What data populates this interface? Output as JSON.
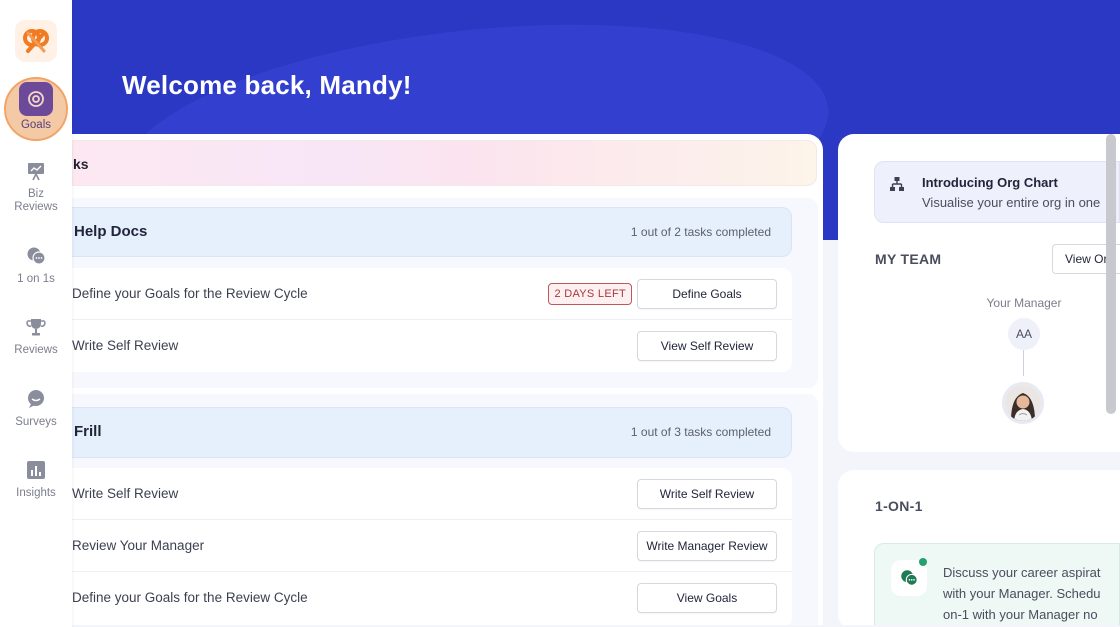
{
  "sidebar": {
    "items": [
      {
        "label": "Goals",
        "icon": "target-icon",
        "active": true
      },
      {
        "label": "Biz\nReviews",
        "icon": "presentation-chart-icon"
      },
      {
        "label": "1 on 1s",
        "icon": "chat-bubbles-icon"
      },
      {
        "label": "Reviews",
        "icon": "trophy-icon"
      },
      {
        "label": "Surveys",
        "icon": "survey-bubble-icon"
      },
      {
        "label": "Insights",
        "icon": "bar-chart-icon"
      }
    ],
    "logo_icon": "pretzel-logo-icon",
    "accent_color": "#6d4a99",
    "highlight_color": "#f3c9a6"
  },
  "hero": {
    "welcome": "Welcome back, Mandy!",
    "background_color": "#2b38c4"
  },
  "tasks": {
    "banner_title": "ks",
    "groups": [
      {
        "title": "Help Docs",
        "count": "1 out of 2 tasks completed",
        "tasks": [
          {
            "label": "Define your Goals for the Review Cycle",
            "badge": "2 DAYS LEFT",
            "button": "Define Goals"
          },
          {
            "label": "Write Self Review",
            "button": "View Self Review"
          }
        ]
      },
      {
        "title": "Frill",
        "count": "1 out of 3 tasks completed",
        "tasks": [
          {
            "label": "Write Self Review",
            "button": "Write Self Review"
          },
          {
            "label": "Review Your Manager",
            "button": "Write Manager Review"
          },
          {
            "label": "Define your Goals for the Review Cycle",
            "button": "View Goals"
          }
        ]
      }
    ]
  },
  "org_chart": {
    "title": "Introducing Org Chart",
    "subtitle": "Visualise your entire org in one",
    "icon": "org-chart-icon"
  },
  "my_team": {
    "title": "MY TEAM",
    "view_button": "View Or",
    "manager_label": "Your Manager",
    "manager_initials": "AA"
  },
  "one_on_one": {
    "title": "1-ON-1",
    "lines": [
      "Discuss your career aspirat",
      "with your Manager. Schedu",
      "on-1 with your Manager no"
    ],
    "icon": "chat-bubbles-icon",
    "status_color": "#23a26d"
  }
}
